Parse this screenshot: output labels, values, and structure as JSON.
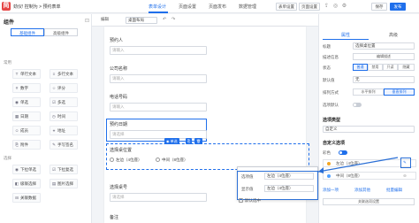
{
  "topbar": {
    "logo_letter": "简",
    "app_title": "劲仪! 控制为 > 预约表单",
    "tabs": [
      {
        "label": "表单设计"
      },
      {
        "label": "页面设置"
      },
      {
        "label": "页面发布"
      },
      {
        "label": "数据管理"
      }
    ],
    "btn_preview": "表单设置",
    "btn_page_settings": "页面设置",
    "btn_save": "保存",
    "btn_publish": "发布"
  },
  "sidebar": {
    "title": "组件",
    "tabs": [
      {
        "label": "基础组件"
      },
      {
        "label": "高级组件"
      }
    ],
    "section_common": "常用",
    "common": [
      {
        "icon": "T",
        "label": "单行文本"
      },
      {
        "icon": "≡",
        "label": "多行文本"
      },
      {
        "icon": "#",
        "label": "数字"
      },
      {
        "icon": "☆",
        "label": "评分"
      },
      {
        "icon": "◉",
        "label": "单选"
      },
      {
        "icon": "☑",
        "label": "多选"
      },
      {
        "icon": "▦",
        "label": "日期"
      },
      {
        "icon": "◷",
        "label": "时间"
      },
      {
        "icon": "☺",
        "label": "成员"
      },
      {
        "icon": "⌖",
        "label": "地址"
      },
      {
        "icon": "⎘",
        "label": "附件"
      },
      {
        "icon": "✎",
        "label": "手写签名"
      }
    ],
    "section_select": "选择",
    "select": [
      {
        "icon": "◉",
        "label": "下拉单选"
      },
      {
        "icon": "☑",
        "label": "下拉复选"
      },
      {
        "icon": "◧",
        "label": "级联选择"
      },
      {
        "icon": "▤",
        "label": "图片选择"
      },
      {
        "icon": "⊟",
        "label": "关联数据"
      }
    ]
  },
  "canvas_bar": {
    "label": "编辑",
    "layout_select": "桌面布局",
    "undo": "↶",
    "redo": "↷"
  },
  "form": {
    "fields": [
      {
        "label": "预约人",
        "placeholder": "请输入"
      },
      {
        "label": "公司名称",
        "placeholder": "请输入"
      },
      {
        "label": "电话号码",
        "placeholder": "请输入"
      },
      {
        "label": "预约日期",
        "placeholder": "请选择"
      }
    ],
    "radio_field": {
      "label": "选择桌位置",
      "options": [
        "左边（4位座）",
        "中间（8位座）"
      ]
    },
    "select_field": {
      "label": "选择桌号",
      "placeholder": "请选择"
    },
    "remark_label": "备注",
    "chip_label": "◉ 单选"
  },
  "props": {
    "tabs": [
      {
        "label": "属性"
      },
      {
        "label": "高级"
      }
    ],
    "title_label": "标题",
    "title_value": "选择桌位置",
    "desc_label": "描述信息",
    "desc_btn": "编辑描述",
    "state_label": "状态",
    "state_options": [
      "普通",
      "禁用",
      "只读",
      "隐藏"
    ],
    "default_label": "默认值",
    "default_value": "无",
    "layout_label": "排列方式",
    "layout_options": [
      "水平排列",
      "垂直排列"
    ],
    "show_label": "选项默认",
    "type_section": "选项类型",
    "type_value": "自定义",
    "custom_section": "自定义选项",
    "color_label": "彩色",
    "options": [
      {
        "label": "左边（4位座）",
        "color": "#f4a623"
      },
      {
        "label": "中间（8位座）",
        "color": "#4e9fff"
      }
    ],
    "add_option": "添加一项",
    "add_other": "添加其他",
    "batch_edit": "批量编辑",
    "link_options": "关联选项设置"
  },
  "popup": {
    "value_label": "选项值",
    "value": "左边（4位座）",
    "display_label": "显示值",
    "display_value": "左边（4位座）",
    "default_check": "默认选中"
  }
}
